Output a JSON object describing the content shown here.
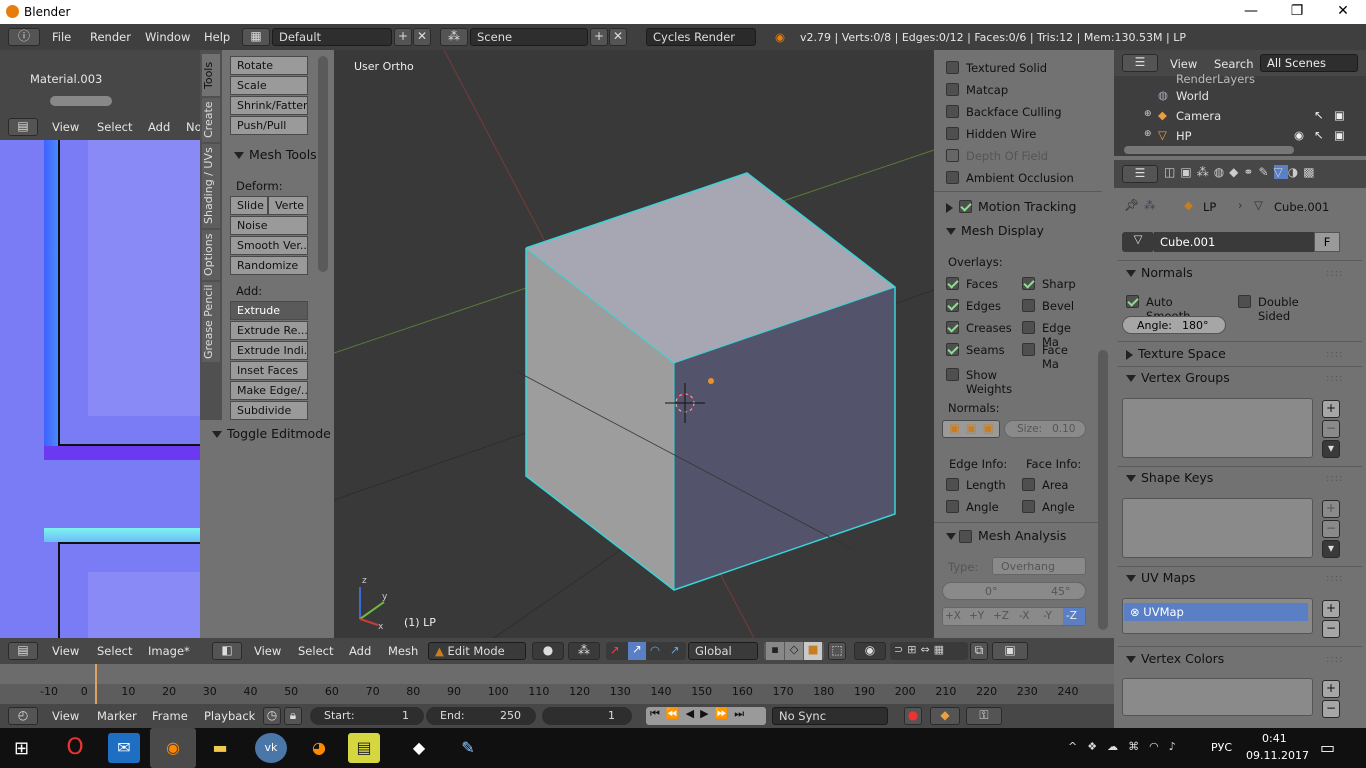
{
  "window": {
    "title": "Blender",
    "minimize": "—",
    "restore": "❐",
    "close": "✕"
  },
  "infobar": {
    "menus": [
      "File",
      "Render",
      "Window",
      "Help"
    ],
    "screen": "Default",
    "scene": "Scene",
    "engine": "Cycles Render",
    "stats": "v2.79 | Verts:0/8 | Edges:0/12 | Faces:0/6 | Tris:12 | Mem:130.53M | LP"
  },
  "material": {
    "name": "Material.003"
  },
  "image_editor": {
    "menus": [
      "View",
      "Select",
      "Image*"
    ],
    "header_menus": [
      "View",
      "Select",
      "Add",
      "No"
    ]
  },
  "tools": {
    "tabs": [
      "Tools",
      "Create",
      "Shading / UVs",
      "Options",
      "Grease Pencil"
    ],
    "transform": [
      "Rotate",
      "Scale",
      "Shrink/Fatten",
      "Push/Pull"
    ],
    "mesh_tools_title": "Mesh Tools",
    "deform_label": "Deform:",
    "slide": "Slide",
    "vertex": "Verte",
    "deform": [
      "Noise",
      "Smooth Ver...",
      "Randomize"
    ],
    "add_label": "Add:",
    "extrude": "Extrude",
    "add": [
      "Extrude Re...",
      "Extrude Indi...",
      "Inset Faces",
      "Make Edge/...",
      "Subdivide"
    ],
    "toggle": "Toggle Editmode"
  },
  "viewport": {
    "view_label": "User Ortho",
    "object_label": "(1) LP",
    "axes": {
      "z": "z",
      "y": "y",
      "x": "x"
    },
    "menus": [
      "View",
      "Select",
      "Add",
      "Mesh"
    ],
    "mode": "Edit Mode",
    "orientation": "Global"
  },
  "properties_panel": {
    "shading": [
      "Textured Solid",
      "Matcap",
      "Backface Culling",
      "Hidden Wire",
      "Depth Of Field",
      "Ambient Occlusion"
    ],
    "motion_tracking": "Motion Tracking",
    "mesh_display": "Mesh Display",
    "overlays_label": "Overlays:",
    "overlays_left": [
      {
        "label": "Faces",
        "on": true
      },
      {
        "label": "Edges",
        "on": true
      },
      {
        "label": "Creases",
        "on": true
      },
      {
        "label": "Seams",
        "on": true
      }
    ],
    "overlays_right": [
      {
        "label": "Sharp",
        "on": true
      },
      {
        "label": "Bevel",
        "on": false
      },
      {
        "label": "Edge Ma",
        "on": false
      },
      {
        "label": "Face Ma",
        "on": false
      }
    ],
    "show_weights": "Show Weights",
    "normals_label": "Normals:",
    "size": "Size:",
    "size_value": "0.10",
    "edge_info": "Edge Info:",
    "face_info": "Face Info:",
    "length": "Length",
    "area": "Area",
    "angle": "Angle",
    "mesh_analysis": "Mesh Analysis",
    "type_label": "Type:",
    "type_value": "Overhang",
    "deg_min": "0°",
    "deg_max": "45°",
    "axis_buttons": [
      "+X",
      "+Y",
      "+Z",
      "-X",
      "-Y",
      "-Z"
    ]
  },
  "outliner": {
    "menus": [
      "View",
      "Search"
    ],
    "filter": "All Scenes",
    "items": [
      "RenderLayers",
      "World",
      "Camera",
      "HP"
    ]
  },
  "props": {
    "breadcrumb": [
      "LP",
      "Cube.001"
    ],
    "mesh_name": "Cube.001",
    "fake_user": "F",
    "normals": "Normals",
    "auto_smooth": "Auto Smooth",
    "double_sided": "Double Sided",
    "angle_label": "Angle:",
    "angle_value": "180°",
    "texture_space": "Texture Space",
    "vertex_groups": "Vertex Groups",
    "shape_keys": "Shape Keys",
    "uv_maps": "UV Maps",
    "uvmap": "UVMap",
    "vertex_colors": "Vertex Colors"
  },
  "timeline": {
    "ticks": [
      "-10",
      "0",
      "10",
      "20",
      "30",
      "40",
      "50",
      "60",
      "70",
      "80",
      "90",
      "100",
      "110",
      "120",
      "130",
      "140",
      "150",
      "160",
      "170",
      "180",
      "190",
      "200",
      "210",
      "220",
      "230",
      "240"
    ],
    "menus": [
      "View",
      "Marker",
      "Frame",
      "Playback"
    ],
    "start_label": "Start:",
    "start": "1",
    "end_label": "End:",
    "end": "250",
    "current": "1",
    "sync": "No Sync"
  },
  "taskbar": {
    "lang": "РУС",
    "time": "0:41",
    "date": "09.11.2017"
  }
}
